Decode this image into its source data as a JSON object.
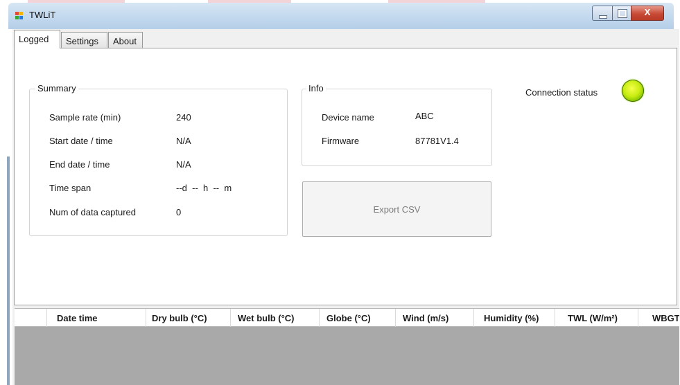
{
  "window": {
    "title": "TWLiT",
    "controls": {
      "minimize": "minimize",
      "maximize": "maximize",
      "close": "X"
    }
  },
  "tabs": [
    {
      "label": "Logged",
      "active": true
    },
    {
      "label": "Settings",
      "active": false
    },
    {
      "label": "About",
      "active": false
    }
  ],
  "summary": {
    "title": "Summary",
    "rows": [
      {
        "label": "Sample rate (min)",
        "value": "240"
      },
      {
        "label": "Start date / time",
        "value": "N/A"
      },
      {
        "label": "End date / time",
        "value": "N/A"
      },
      {
        "label": "Time span",
        "value": "--d  --  h  --  m"
      },
      {
        "label": "Num of data captured",
        "value": "0"
      }
    ]
  },
  "info": {
    "title": "Info",
    "rows": [
      {
        "label": "Device name",
        "value": "ABC"
      },
      {
        "label": "Firmware",
        "value": "87781V1.4"
      }
    ]
  },
  "export_button": {
    "label": "Export CSV",
    "enabled": false
  },
  "connection": {
    "label": "Connection status",
    "led_color": "#c8ec12",
    "connected": true
  },
  "grid": {
    "columns": [
      "",
      "Date time",
      "Dry bulb (°C)",
      "Wet bulb (°C)",
      "Globe (°C)",
      "Wind (m/s)",
      "Humidity (%)",
      "TWL (W/m²)",
      "WBGT"
    ],
    "rows": []
  },
  "colors": {
    "grid_body": "#a9a9a9",
    "titlebar": "#c6dbef",
    "close_button": "#c84b36"
  },
  "icons": [
    "app-icon",
    "minimize-icon",
    "maximize-icon",
    "close-icon",
    "status-led-icon"
  ]
}
